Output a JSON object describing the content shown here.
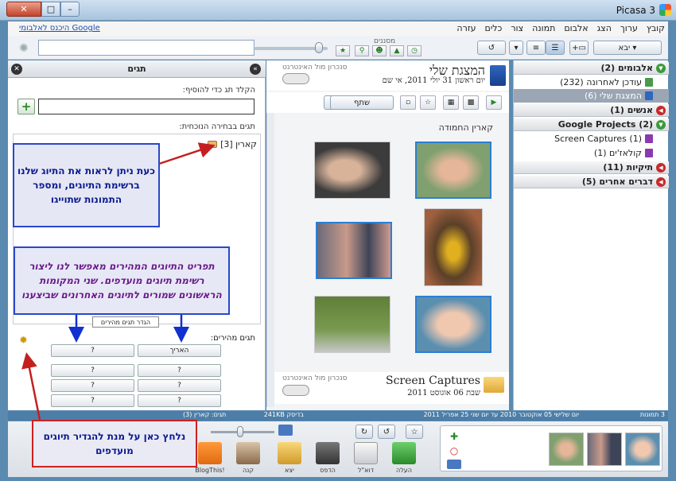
{
  "window": {
    "title": "Picasa 3",
    "close": "✕",
    "max": "□",
    "min": "–"
  },
  "menu": {
    "items": [
      "קובץ",
      "ערוך",
      "הצג",
      "אלבום",
      "תמונה",
      "צור",
      "כלים",
      "עזרה"
    ],
    "google_link": "היכנס לאלבומי Google"
  },
  "toolbar": {
    "import_label": "יבא",
    "filters_label": "מסננים",
    "search_placeholder": ""
  },
  "tags_panel": {
    "title": "תגים",
    "add_label": "הקלד תג כדי להוסיף:",
    "current_label": "תגים בבחירה הנוכחית:",
    "current_tag": "קארין [3]",
    "quick_label": "תגים מהירים:",
    "define_tooltip": "הגדר תגים מהירים",
    "quick_tags": [
      "האריך",
      "?",
      "?",
      "?",
      "?",
      "?",
      "?",
      "?"
    ]
  },
  "callouts": {
    "tags": "כעת ניתן לראות את התיוג שלנו ברשימת התיוגים, ומספר התמונות שתוייגו",
    "quick": "תפריט התיוגים המהירים מאפשר לנו ליצור רשימת תיוגים מועדפים. שני המקומות הראשונים שמורים לתיוגים האחרונים שביצענו",
    "define": "נלחץ כאן על מנת להגדיר תיוגים מועדפים"
  },
  "album": {
    "title": "המצגת שלי",
    "date": "יום ראשון 31 יולי 2011, אי שם",
    "sync_label": "סנכרון מול האינטרנט",
    "share_label": "שתף",
    "section_label": "קארין החמודה"
  },
  "screen_captures": {
    "title": "Screen Captures",
    "date": "שבת 06 אוגוסט 2011",
    "sync_label": "סנכרון מול האינטרנט"
  },
  "tree": {
    "albums": "אלבומים (2)",
    "recent": "עודכן לאחרונה (232)",
    "my_show": "המצגת שלי (6)",
    "people": "אנשים (1)",
    "google_projects": "Google Projects (2)",
    "screen_captures": "Screen Captures (1)",
    "collages": "קולאז'ים (1)",
    "folders": "תיקיות (11)",
    "other": "דברים אחרים (5)"
  },
  "status": {
    "count": "3 תמונות",
    "range": "יום שלישי 05 אוקטובר 2010 עד יום שני 25 אפריל 2011",
    "size": "241KB בדיסק",
    "tags": "תגים: קארין (3)"
  },
  "bottom": {
    "actions": [
      "העלה",
      "דוא\"ל",
      "הדפס",
      "יצא",
      "קנה",
      "BlogThis!"
    ]
  },
  "colors": {
    "accent": "#2a47c9",
    "status_bar": "#4d7ea8",
    "arrow_red": "#c42020",
    "arrow_blue": "#1030d0"
  }
}
